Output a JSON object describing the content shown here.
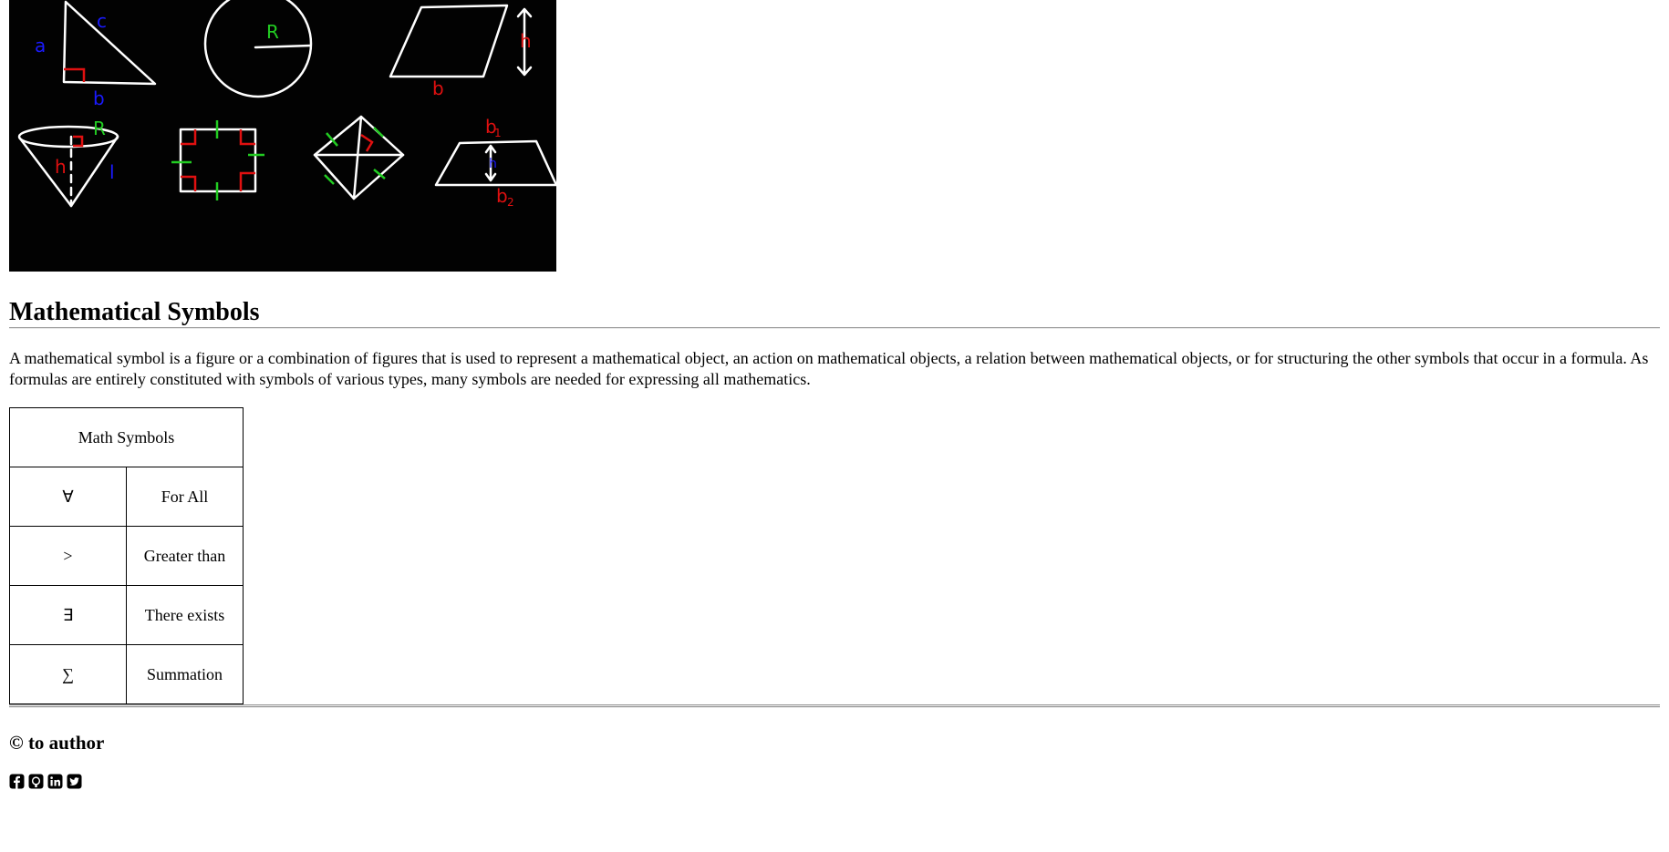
{
  "hero": {
    "alt": "geometry shapes sketch",
    "labels": {
      "triangle_a": "a",
      "triangle_b": "b",
      "triangle_c": "c",
      "circle_r": "R",
      "parallelogram_h": "h",
      "parallelogram_b": "b",
      "cone_h": "h",
      "cone_r": "R",
      "cone_l": "l",
      "trap_b1": "b",
      "trap_b1_sub": "1",
      "trap_h": "h",
      "trap_b2": "b",
      "trap_b2_sub": "2"
    },
    "colors": {
      "background": "#020202",
      "stroke": "#ffffff",
      "blue": "#1a1aff",
      "green": "#22cc22",
      "red": "#e01010"
    }
  },
  "page": {
    "title": "Mathematical Symbols",
    "intro": "A mathematical symbol is a figure or a combination of figures that is used to represent a mathematical object, an action on mathematical objects, a relation between mathematical objects, or for structuring the other symbols that occur in a formula. As formulas are entirely constituted with symbols of various types, many symbols are needed for expressing all mathematics."
  },
  "table": {
    "header": "Math Symbols",
    "rows": [
      {
        "symbol": "∀",
        "meaning": "For All"
      },
      {
        "symbol": ">",
        "meaning": "Greater than"
      },
      {
        "symbol": "∃",
        "meaning": "There exists"
      },
      {
        "symbol": "∑",
        "meaning": "Summation"
      }
    ]
  },
  "footer": {
    "title": "© to author",
    "social_icons": [
      "facebook-icon",
      "github-icon",
      "linkedin-icon",
      "twitter-icon"
    ]
  }
}
